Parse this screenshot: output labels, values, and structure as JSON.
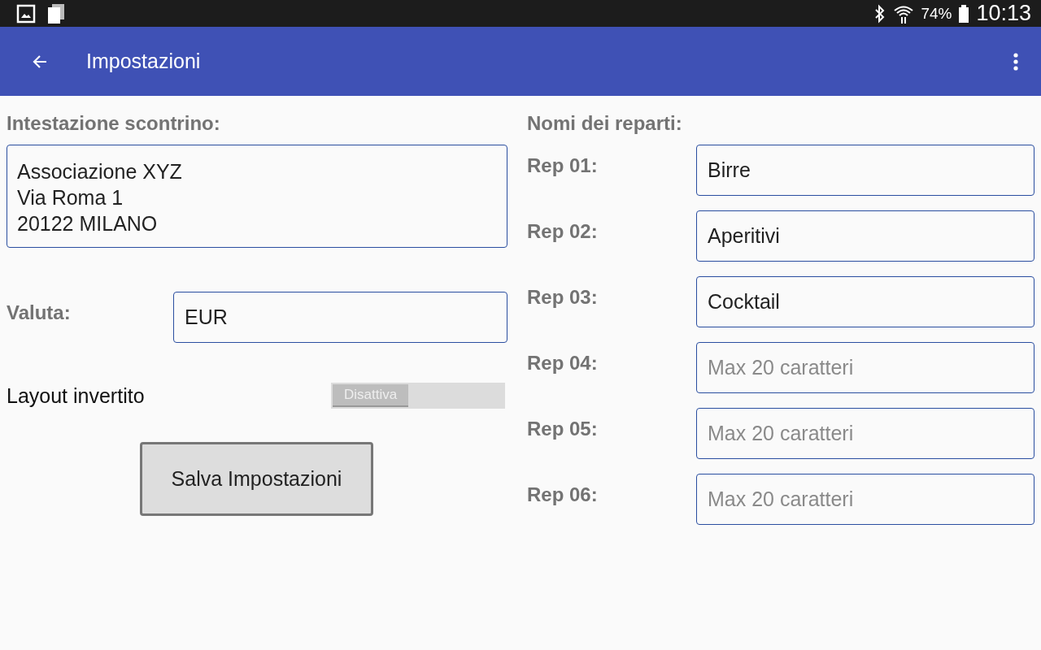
{
  "status_bar": {
    "battery": "74%",
    "time": "10:13"
  },
  "toolbar": {
    "title": "Impostazioni"
  },
  "receipt_header": {
    "label": "Intestazione scontrino:",
    "lines": [
      "Associazione XYZ",
      "Via Roma 1",
      "20122 MILANO"
    ]
  },
  "currency": {
    "label": "Valuta:",
    "value": "EUR"
  },
  "inverted_layout": {
    "label": "Layout invertito",
    "on": false,
    "state_text": "Disattiva"
  },
  "save_button": "Salva Impostazioni",
  "departments": {
    "label": "Nomi dei reparti:",
    "items": [
      {
        "label": "Rep 01:",
        "value": "Birre"
      },
      {
        "label": "Rep 02:",
        "value": "Aperitivi"
      },
      {
        "label": "Rep 03:",
        "value": "Cocktail"
      },
      {
        "label": "Rep 04:",
        "placeholder": "Max 20 caratteri"
      },
      {
        "label": "Rep 05:",
        "placeholder": "Max 20 caratteri"
      },
      {
        "label": "Rep 06:",
        "placeholder": "Max 20 caratteri"
      }
    ]
  }
}
